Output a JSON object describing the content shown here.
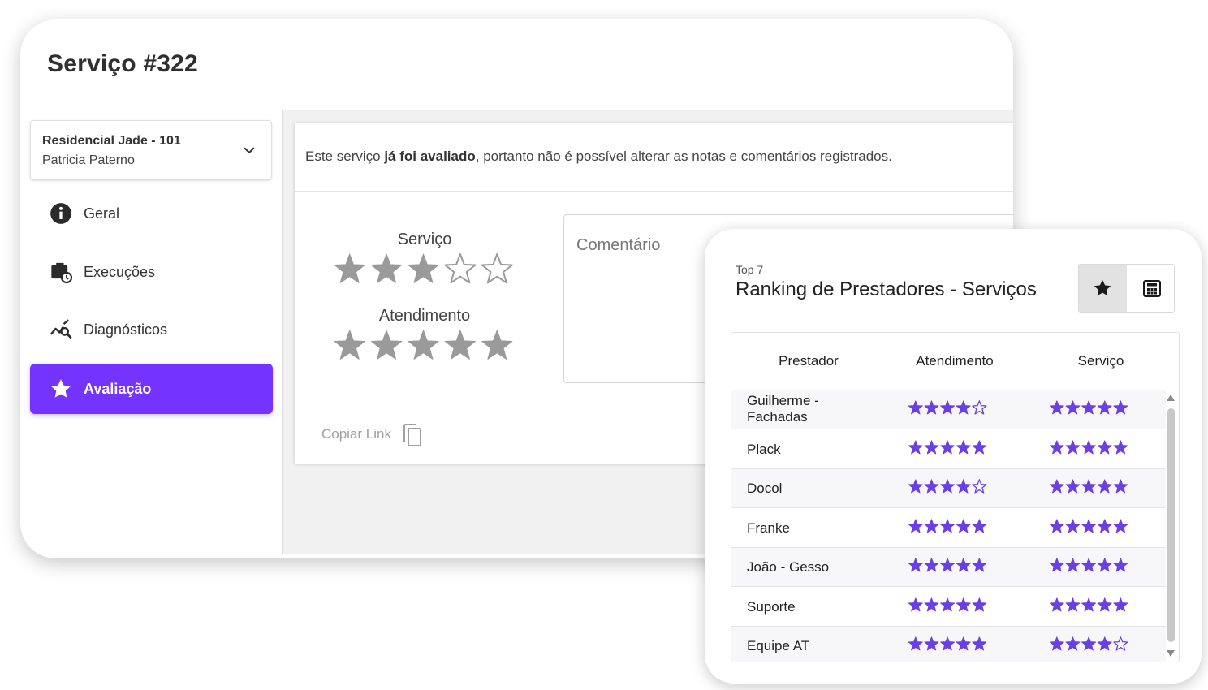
{
  "page": {
    "title": "Serviço #322"
  },
  "selector": {
    "line1": "Residencial Jade - 101",
    "line2": "Patricia Paterno",
    "icon": "chevron-down-icon"
  },
  "nav": {
    "items": [
      {
        "label": "Geral",
        "icon": "info-icon",
        "active": false
      },
      {
        "label": "Execuções",
        "icon": "briefcase-clock-icon",
        "active": false
      },
      {
        "label": "Diagnósticos",
        "icon": "chart-search-icon",
        "active": false
      },
      {
        "label": "Avaliação",
        "icon": "star-icon",
        "active": true
      }
    ]
  },
  "evaluation": {
    "notice_prefix": "Este serviço ",
    "notice_bold": "já foi avaliado",
    "notice_suffix": ", portanto não é possível alterar as notas e comentários registrados.",
    "ratings": [
      {
        "label": "Serviço",
        "value": 3,
        "max": 5
      },
      {
        "label": "Atendimento",
        "value": 5,
        "max": 5
      }
    ],
    "comment_placeholder": "Comentário",
    "copy_link_label": "Copiar Link"
  },
  "ranking": {
    "subtitle": "Top 7",
    "title": "Ranking de Prestadores - Serviços",
    "toggle": [
      "star-icon",
      "calculator-icon"
    ],
    "headers": [
      "Prestador",
      "Atendimento",
      "Serviço"
    ],
    "rows": [
      {
        "name": "Guilherme - Fachadas",
        "atendimento": 4,
        "servico": 5
      },
      {
        "name": "Plack",
        "atendimento": 5,
        "servico": 5
      },
      {
        "name": "Docol",
        "atendimento": 4,
        "servico": 5
      },
      {
        "name": "Franke",
        "atendimento": 5,
        "servico": 5
      },
      {
        "name": "João - Gesso",
        "atendimento": 5,
        "servico": 5
      },
      {
        "name": "Suporte",
        "atendimento": 5,
        "servico": 5
      },
      {
        "name": "Equipe AT",
        "atendimento": 5,
        "servico": 4
      }
    ]
  },
  "colors": {
    "accent": "#7433ff",
    "star_gray": "#9a9a9a",
    "star_purple": "#6a3fe4"
  }
}
